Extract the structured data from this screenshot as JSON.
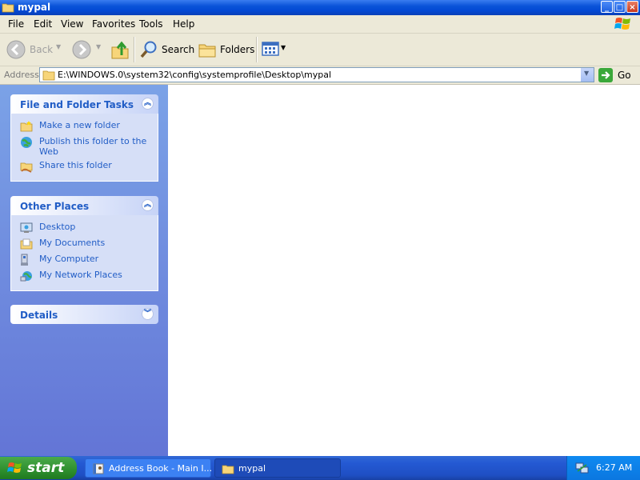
{
  "window": {
    "title": "mypal",
    "controls": {
      "minimize": "_",
      "maximize": "□",
      "close": "×"
    }
  },
  "menu": [
    "File",
    "Edit",
    "View",
    "Favorites",
    "Tools",
    "Help"
  ],
  "toolbar": {
    "back": "Back",
    "search": "Search",
    "folders": "Folders"
  },
  "address": {
    "label": "Address",
    "value": "E:\\WINDOWS.0\\system32\\config\\systemprofile\\Desktop\\mypal",
    "go": "Go"
  },
  "taskpane": {
    "file_tasks": {
      "title": "File and Folder Tasks",
      "links": [
        "Make a new folder",
        "Publish this folder to the Web",
        "Share this folder"
      ]
    },
    "other_places": {
      "title": "Other Places",
      "links": [
        "Desktop",
        "My Documents",
        "My Computer",
        "My Network Places"
      ]
    },
    "details": {
      "title": "Details"
    }
  },
  "taskbar": {
    "start": "start",
    "items": [
      "Address Book - Main I...",
      "mypal"
    ],
    "clock": "6:27 AM"
  },
  "colors": {
    "titlebar": "#0a53d8",
    "taskpane": "#6f8ee0",
    "link": "#215dc6",
    "taskbar": "#2459d3",
    "start": "#2e8f2e"
  }
}
